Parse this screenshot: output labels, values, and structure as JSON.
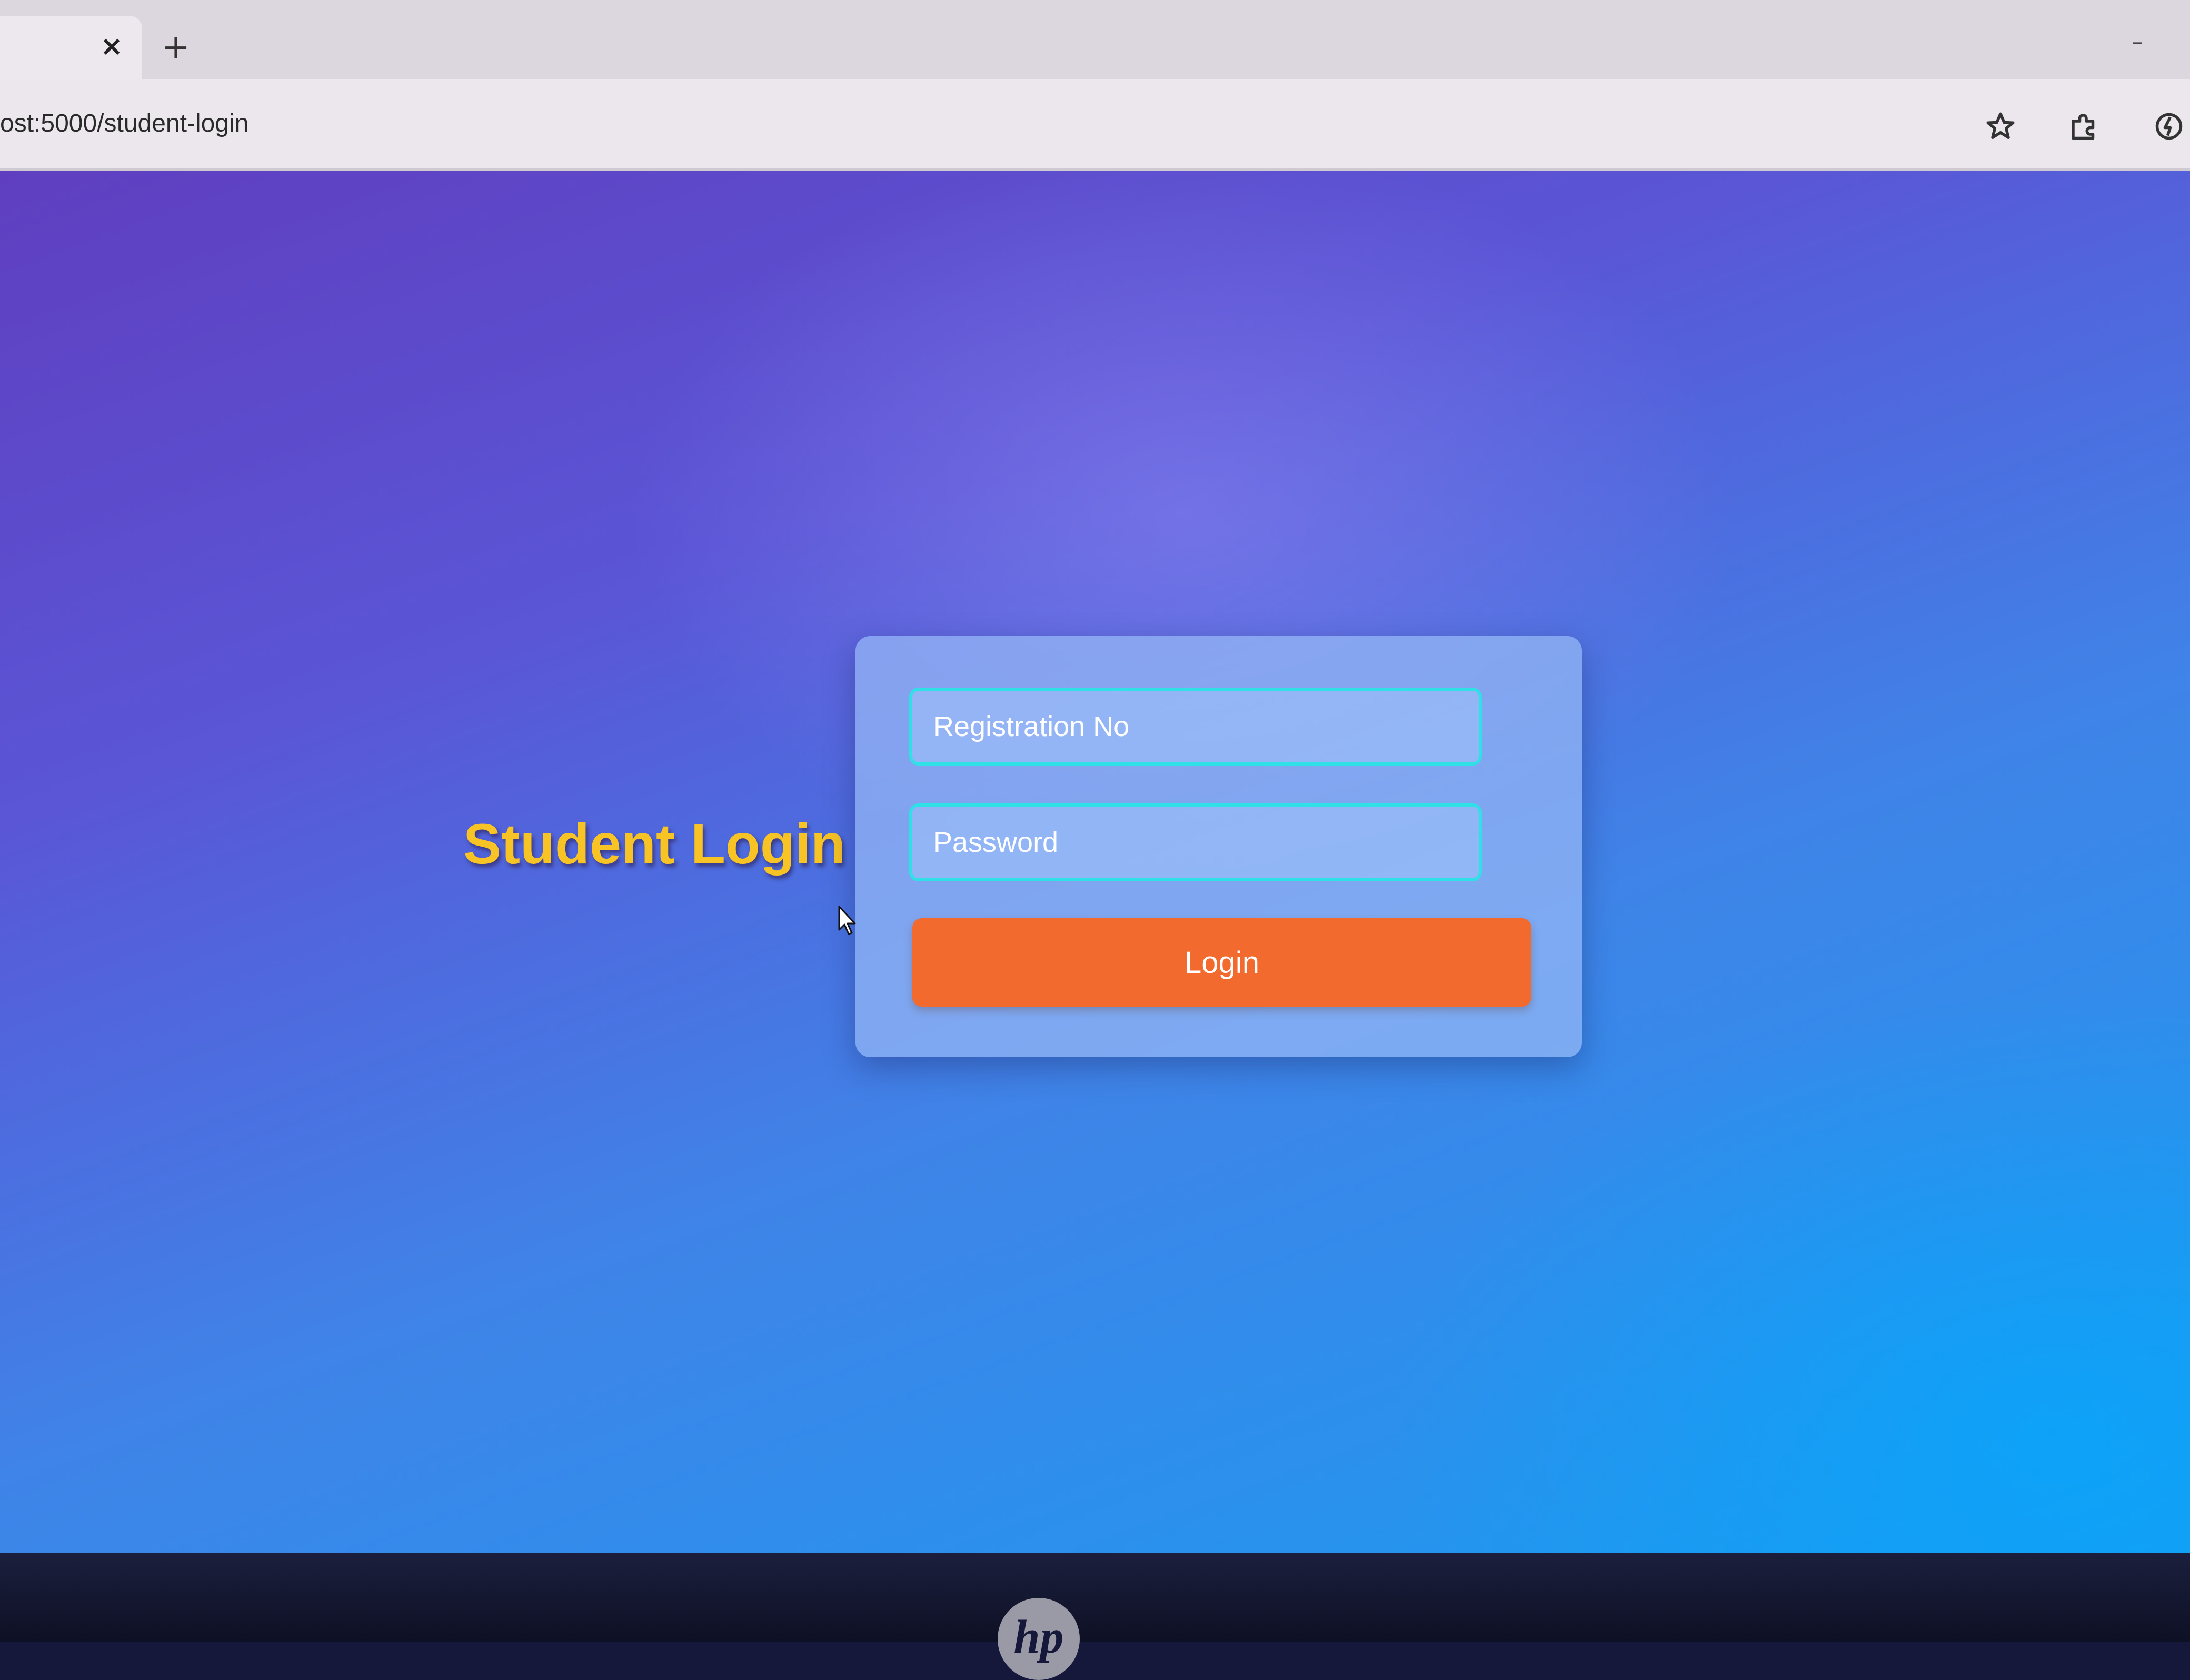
{
  "browser": {
    "tab_close": "×",
    "new_tab": "+",
    "minimize": "–",
    "url": "ost:5000/student-login",
    "bookmark_icon": "star-icon",
    "extensions_icon": "puzzle-icon",
    "profile_icon": "sync-icon"
  },
  "page": {
    "heading": "Student Login",
    "registration_placeholder": "Registration No",
    "password_placeholder": "Password",
    "login_label": "Login"
  },
  "device": {
    "logo": "hp"
  },
  "colors": {
    "heading": "#f7c325",
    "login_button": "#f36a2e",
    "field_border": "#2fe0e6"
  }
}
